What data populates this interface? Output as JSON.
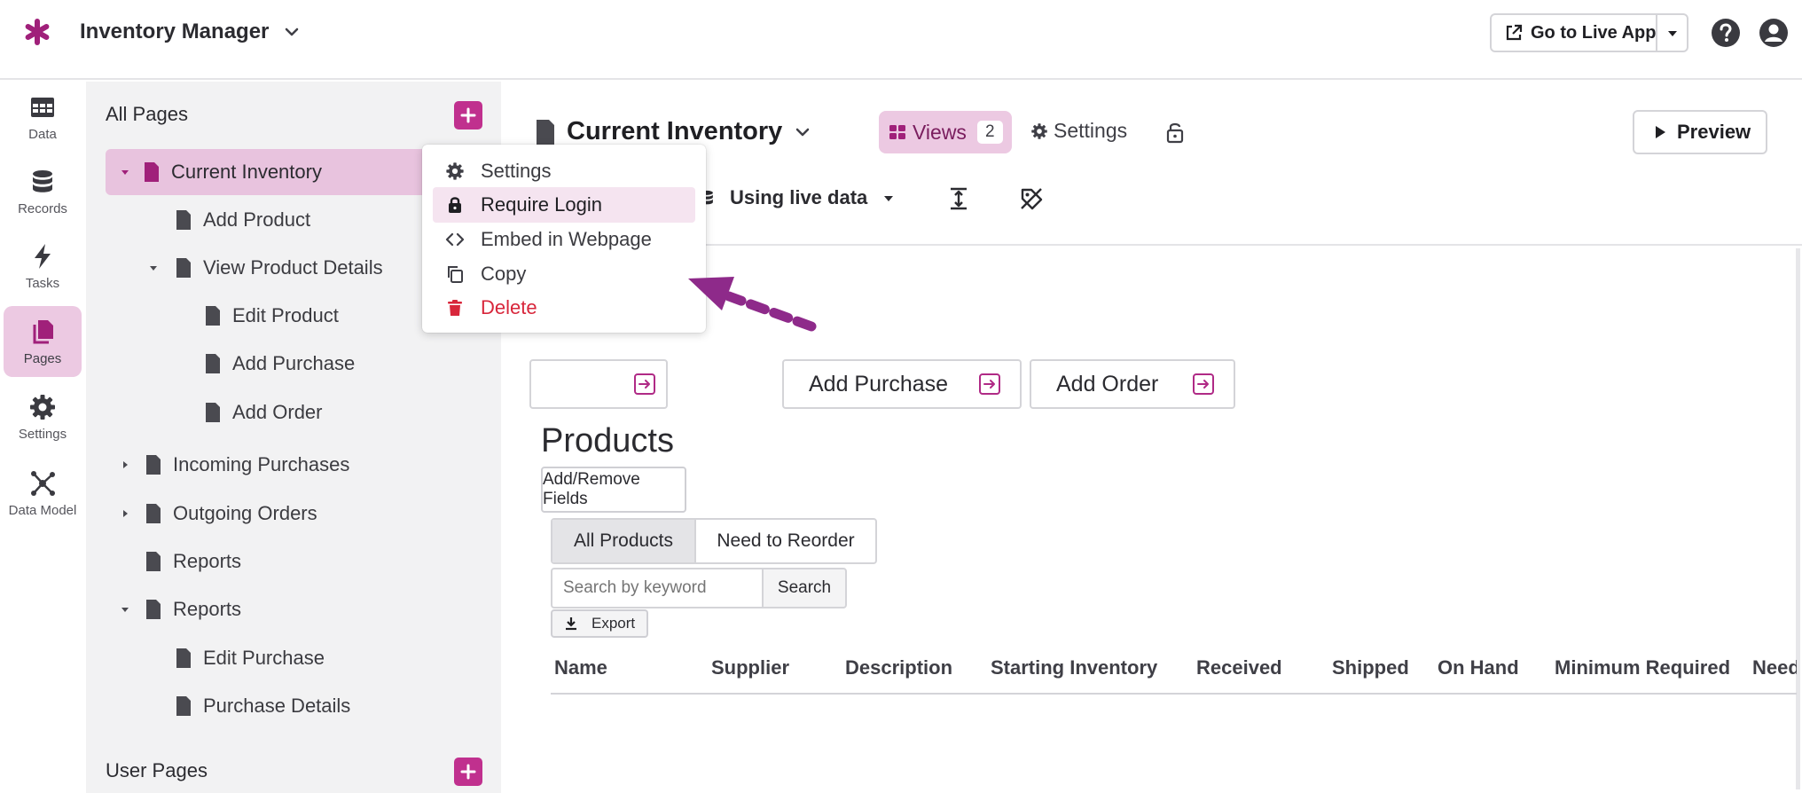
{
  "app": {
    "title": "Inventory Manager",
    "go_live_label": "Go to Live App",
    "brand_color": "#a0207a",
    "accent_color": "#c0308e"
  },
  "rail": [
    {
      "label": "Data",
      "icon": "table-icon"
    },
    {
      "label": "Records",
      "icon": "database-icon"
    },
    {
      "label": "Tasks",
      "icon": "bolt-icon"
    },
    {
      "label": "Pages",
      "icon": "pages-icon",
      "active": true
    },
    {
      "label": "Settings",
      "icon": "gear-icon"
    },
    {
      "label": "Data Model",
      "icon": "graph-icon"
    }
  ],
  "tree": {
    "all_pages_label": "All Pages",
    "user_pages_label": "User Pages",
    "items": [
      {
        "label": "Current Inventory",
        "selected": true
      },
      {
        "label": "Add Product"
      },
      {
        "label": "View Product Details"
      },
      {
        "label": "Edit Product"
      },
      {
        "label": "Add Purchase"
      },
      {
        "label": "Add Order"
      },
      {
        "label": "Incoming Purchases"
      },
      {
        "label": "Outgoing Orders"
      },
      {
        "label": "Reports"
      },
      {
        "label": "Reports"
      },
      {
        "label": "Edit Purchase"
      },
      {
        "label": "Purchase Details"
      }
    ]
  },
  "context_menu": {
    "items": [
      {
        "label": "Settings",
        "icon": "gear-icon"
      },
      {
        "label": "Require Login",
        "icon": "lock-icon",
        "highlighted": true
      },
      {
        "label": "Embed in Webpage",
        "icon": "code-icon"
      },
      {
        "label": "Copy",
        "icon": "copy-icon"
      },
      {
        "label": "Delete",
        "icon": "trash-icon",
        "danger_color": "#d8263b"
      }
    ]
  },
  "page": {
    "title": "Current Inventory",
    "views_label": "Views",
    "views_count": "2",
    "settings_label": "Settings",
    "preview_label": "Preview",
    "data_source_label": "Using live data"
  },
  "menu_buttons": [
    {
      "label": ""
    },
    {
      "label": "Add Purchase"
    },
    {
      "label": "Add Order"
    }
  ],
  "products": {
    "title": "Products",
    "fields_button": "Add/Remove Fields",
    "tabs": [
      "All Products",
      "Need to Reorder"
    ],
    "search_placeholder": "Search by keyword",
    "search_button": "Search",
    "export_button": "Export",
    "columns": [
      "Name",
      "Supplier",
      "Description",
      "Starting Inventory",
      "Received",
      "Shipped",
      "On Hand",
      "Minimum Required",
      "Need"
    ]
  }
}
